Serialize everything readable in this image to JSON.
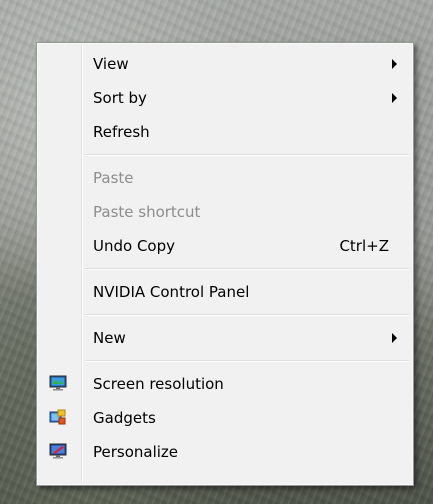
{
  "menu": {
    "group1": [
      {
        "label": "View",
        "submenu": true
      },
      {
        "label": "Sort by",
        "submenu": true
      },
      {
        "label": "Refresh",
        "submenu": false
      }
    ],
    "group2": [
      {
        "label": "Paste",
        "disabled": true
      },
      {
        "label": "Paste shortcut",
        "disabled": true
      },
      {
        "label": "Undo Copy",
        "shortcut": "Ctrl+Z",
        "disabled": false
      }
    ],
    "group3": [
      {
        "label": "NVIDIA Control Panel"
      }
    ],
    "group4": [
      {
        "label": "New",
        "submenu": true
      }
    ],
    "group5": [
      {
        "label": "Screen resolution",
        "icon": "monitor-icon"
      },
      {
        "label": "Gadgets",
        "icon": "gadgets-icon"
      },
      {
        "label": "Personalize",
        "icon": "personalize-icon"
      }
    ]
  }
}
